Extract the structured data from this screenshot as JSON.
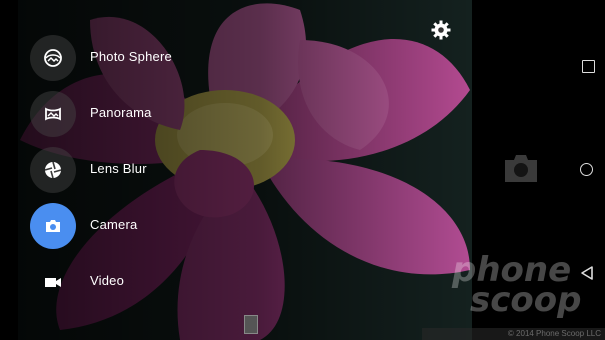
{
  "modes": [
    {
      "label": "Photo Sphere",
      "icon": "photo-sphere-icon"
    },
    {
      "label": "Panorama",
      "icon": "panorama-icon"
    },
    {
      "label": "Lens Blur",
      "icon": "lens-blur-icon"
    },
    {
      "label": "Camera",
      "icon": "camera-icon",
      "active": true
    },
    {
      "label": "Video",
      "icon": "video-icon"
    }
  ],
  "accent_color": "#4a8ef0",
  "watermark": {
    "line1": "phone",
    "line2": "scoop"
  },
  "copyright": "© 2014 Phone Scoop LLC"
}
